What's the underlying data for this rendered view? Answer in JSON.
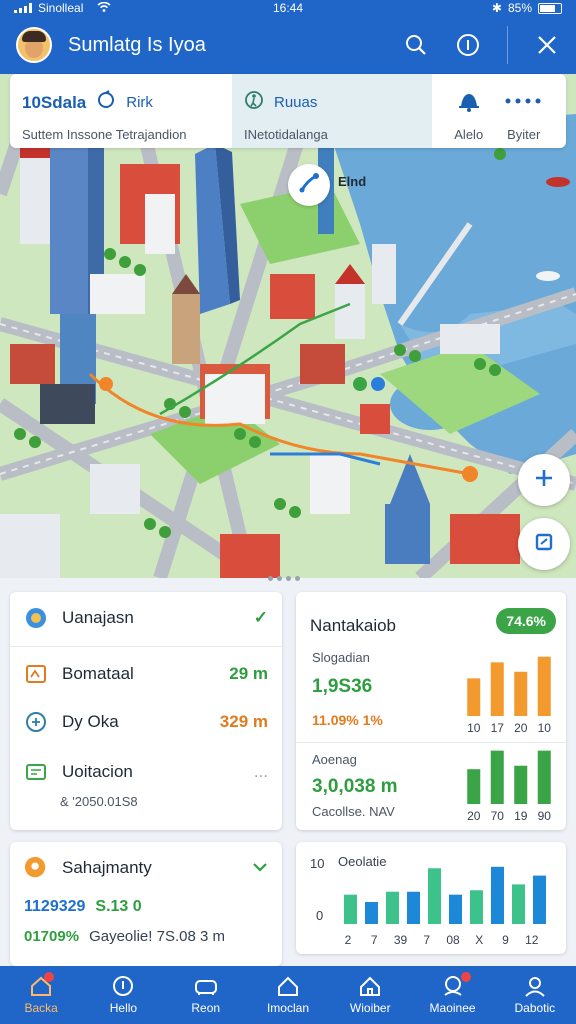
{
  "status_bar": {
    "carrier": "Sinolleal",
    "time": "16:44",
    "battery": "85%"
  },
  "app_bar": {
    "title": "Sumlatg Is Iyoa"
  },
  "route_card": {
    "distance": "10Sdala",
    "link_label": "Rirk",
    "subtitle_left": "Suttem Inssone Tetrajandion",
    "mode_label": "Ruuas",
    "subtitle_right": "INetotidalanga",
    "action1_label": "Alelo",
    "action2_label": "Byiter"
  },
  "map": {
    "pin_label": "Elnd"
  },
  "summary_card": {
    "header": "Uanajasn",
    "rows": [
      {
        "label": "Bomataal",
        "value": "29 m",
        "icon": "map-icon"
      },
      {
        "label": "Dy Oka",
        "value": "329 m",
        "icon": "transit-icon"
      },
      {
        "label": "Uoitacion",
        "value": "...",
        "icon": "ticket-icon"
      }
    ],
    "footnote": "& '2050.01S8"
  },
  "stats_card_1": {
    "title": "Nantakaiob",
    "badge": "74.6%",
    "label1": "Slogadian",
    "num1": "1,9S36",
    "pct": "11.09% 1%",
    "label2": "Aoenag",
    "num2": "3,0,038 m",
    "foot": "Cacollse. NAV"
  },
  "chart_data": [
    {
      "type": "bar",
      "categories": [
        "10",
        "17",
        "20",
        "10"
      ],
      "values": [
        40,
        57,
        47,
        63
      ],
      "color": "#f29a2e"
    },
    {
      "type": "bar",
      "categories": [
        "20",
        "70",
        "19",
        "90"
      ],
      "values": [
        30,
        46,
        33,
        46
      ],
      "color": "#3aa447"
    },
    {
      "type": "bar",
      "title": "Oeolatie",
      "categories": [
        "2",
        "7",
        "39",
        "7",
        "08",
        "X",
        "9",
        "12"
      ],
      "values": [
        4,
        3,
        4.4,
        4.4,
        7.6,
        4,
        4.6,
        7.8,
        5.4,
        6.6
      ],
      "y_ticks": [
        "10",
        "0"
      ],
      "colors": [
        "#3cc28a",
        "#1e88d8"
      ]
    }
  ],
  "info_card": {
    "header": "Sahajmanty",
    "line1_a": "1129329",
    "line1_b": "S.13 0",
    "line2_a": "01709%",
    "line2_b": "Gayeolie! 7S.08 3 m"
  },
  "bottom_nav": [
    {
      "label": "Backa",
      "icon": "home-icon"
    },
    {
      "label": "Hello",
      "icon": "compass-icon"
    },
    {
      "label": "Reon",
      "icon": "car-icon"
    },
    {
      "label": "Imoclan",
      "icon": "house-icon"
    },
    {
      "label": "Wioiber",
      "icon": "building-icon"
    },
    {
      "label": "Maoinee",
      "icon": "chat-icon"
    },
    {
      "label": "Dabotic",
      "icon": "profile-icon"
    }
  ]
}
